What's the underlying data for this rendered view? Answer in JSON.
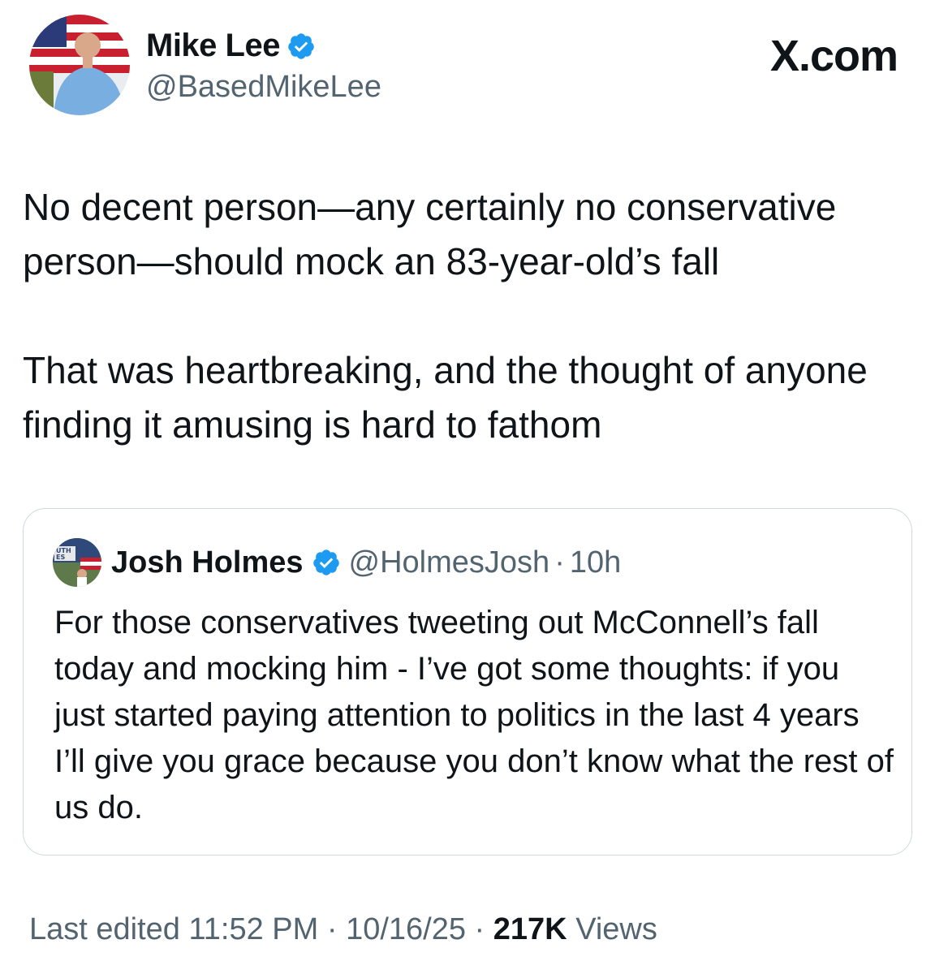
{
  "author": {
    "name": "Mike Lee",
    "handle": "@BasedMikeLee"
  },
  "site_label": "X.com",
  "tweet": {
    "paragraph1": "No decent person—any certainly no conservative person—should mock an 83-year-old’s fall",
    "paragraph2": "That was heartbreaking, and the thought of anyone finding it amusing is hard to fathom"
  },
  "quoted": {
    "name": "Josh Holmes",
    "handle": "@HolmesJosh",
    "separator": "·",
    "time": "10h",
    "avatar_text": "UTH ES",
    "text": "For those conservatives tweeting out McConnell’s fall today and mocking him - I’ve got some thoughts: if you just started paying attention to politics in the last 4 years I’ll give you grace because you don’t know what the rest of us do."
  },
  "footer": {
    "edited": "Last edited 11:52 PM · 10/16/25 ·",
    "views_count": "217K",
    "views_label": "Views"
  },
  "colors": {
    "verified": "#1d9bf0",
    "secondary_text": "#536471",
    "border": "#cfd9de"
  }
}
